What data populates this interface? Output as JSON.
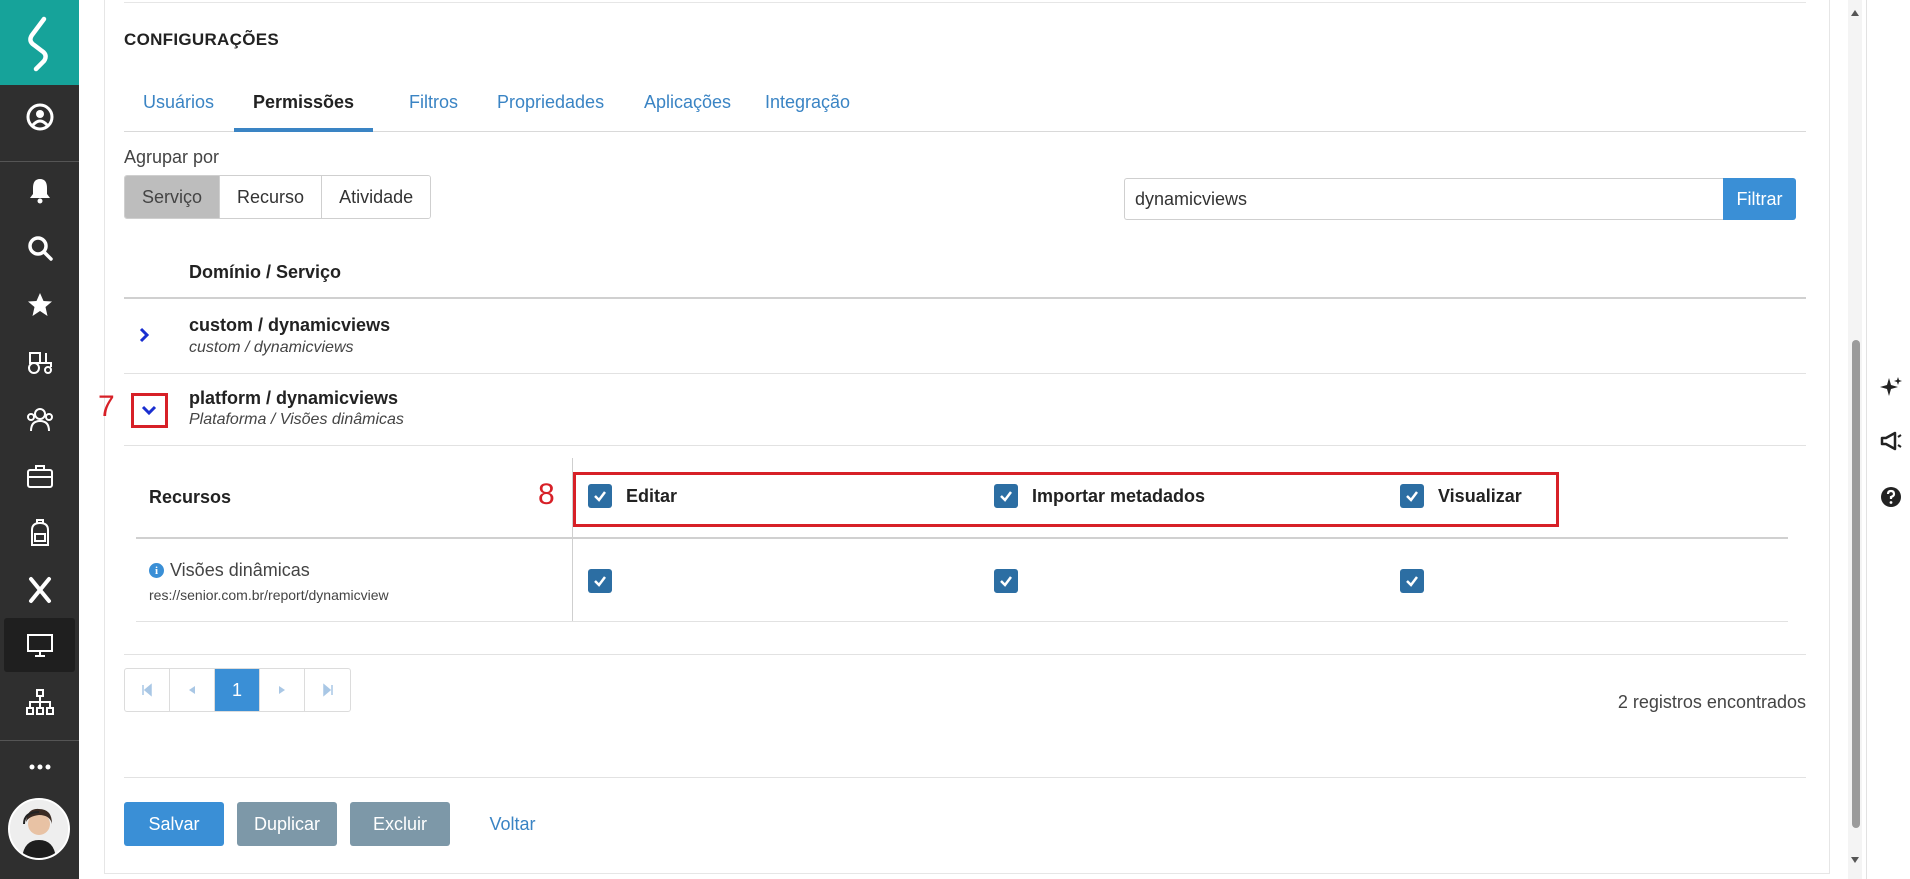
{
  "section_title": "CONFIGURAÇÕES",
  "tabs": [
    {
      "label": "Usuários"
    },
    {
      "label": "Permissões"
    },
    {
      "label": "Filtros"
    },
    {
      "label": "Propriedades"
    },
    {
      "label": "Aplicações"
    },
    {
      "label": "Integração"
    }
  ],
  "active_tab": "Permissões",
  "group_by": {
    "label": "Agrupar por",
    "options": [
      "Serviço",
      "Recurso",
      "Atividade"
    ],
    "selected": "Serviço"
  },
  "search": {
    "value": "dynamicviews",
    "button_label": "Filtrar"
  },
  "list": {
    "header": "Domínio / Serviço",
    "rows": [
      {
        "title": "custom / dynamicviews",
        "subtitle": "custom / dynamicviews",
        "expanded": false
      },
      {
        "title": "platform / dynamicviews",
        "subtitle": "Plataforma / Visões dinâmicas",
        "expanded": true
      }
    ]
  },
  "resources": {
    "header_label": "Recursos",
    "permissions": [
      "Editar",
      "Importar metadados",
      "Visualizar"
    ],
    "items": [
      {
        "name": "Visões dinâmicas",
        "path": "res://senior.com.br/report/dynamicview",
        "editar": true,
        "importar": true,
        "visualizar": true
      }
    ]
  },
  "annotations": {
    "step7": "7",
    "step8": "8"
  },
  "pagination": {
    "current_page": "1",
    "records_text": "2 registros encontrados"
  },
  "actions": {
    "save": "Salvar",
    "duplicate": "Duplicar",
    "delete": "Excluir",
    "back": "Voltar"
  },
  "colors": {
    "accent": "#3a8fd6",
    "brand": "#16a39a",
    "sidebar": "#2f2f2f",
    "annotation": "#d72027",
    "checkbox": "#2c6ea3"
  },
  "sidebar_icons": [
    "logo-icon",
    "user-circle-icon",
    "bell-icon",
    "search-icon",
    "star-icon",
    "tractor-icon",
    "team-icon",
    "briefcase-icon",
    "backpack-icon",
    "x-platform-icon",
    "monitor-icon",
    "org-chart-icon",
    "more-icon"
  ],
  "utility_icons": [
    "sparkle-icon",
    "megaphone-icon",
    "help-icon"
  ]
}
